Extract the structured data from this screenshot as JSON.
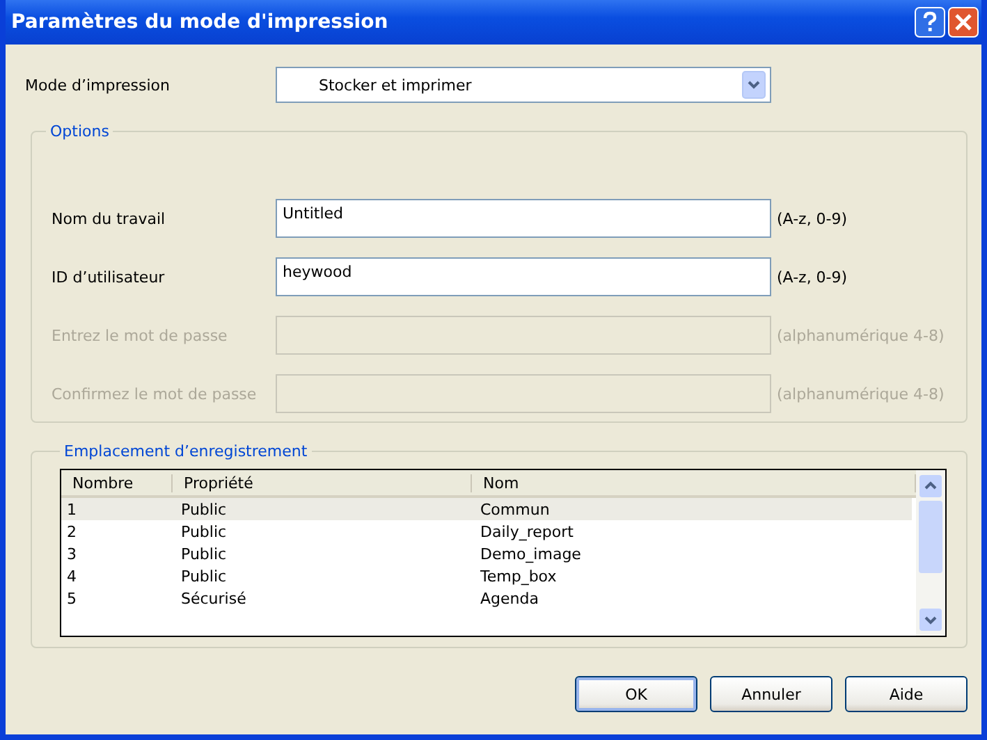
{
  "window": {
    "title": "Paramètres du mode d'impression"
  },
  "print_mode": {
    "label": "Mode d’impression",
    "value": "Stocker et imprimer"
  },
  "options": {
    "title": "Options",
    "fields": [
      {
        "label": "Nom du travail",
        "value": "Untitled",
        "hint": "(A-z, 0-9)",
        "disabled": false
      },
      {
        "label": "ID d’utilisateur",
        "value": "heywood",
        "hint": "(A-z, 0-9)",
        "disabled": false
      },
      {
        "label": "Entrez le mot de passe",
        "hint": "(alphanumérique 4-8)",
        "disabled": true
      },
      {
        "label": "Confirmez le mot de passe",
        "hint": "(alphanumérique 4-8)",
        "disabled": true
      }
    ]
  },
  "storage": {
    "title": "Emplacement d’enregistrement",
    "table": {
      "columns": [
        "Nombre",
        "Propriété",
        "Nom"
      ],
      "rows": [
        {
          "cells": [
            "1",
            "Public",
            "Commun"
          ],
          "selected": true
        },
        {
          "cells": [
            "2",
            "Public",
            "Daily_report"
          ],
          "selected": false
        },
        {
          "cells": [
            "3",
            "Public",
            "Demo_image"
          ],
          "selected": false
        },
        {
          "cells": [
            "4",
            "Public",
            "Temp_box"
          ],
          "selected": false
        },
        {
          "cells": [
            "5",
            "Sécurisé",
            "Agenda"
          ],
          "selected": false
        }
      ]
    }
  },
  "buttons": [
    {
      "label": "OK",
      "default": true
    },
    {
      "label": "Annuler",
      "default": false
    },
    {
      "label": "Aide",
      "default": false
    }
  ]
}
